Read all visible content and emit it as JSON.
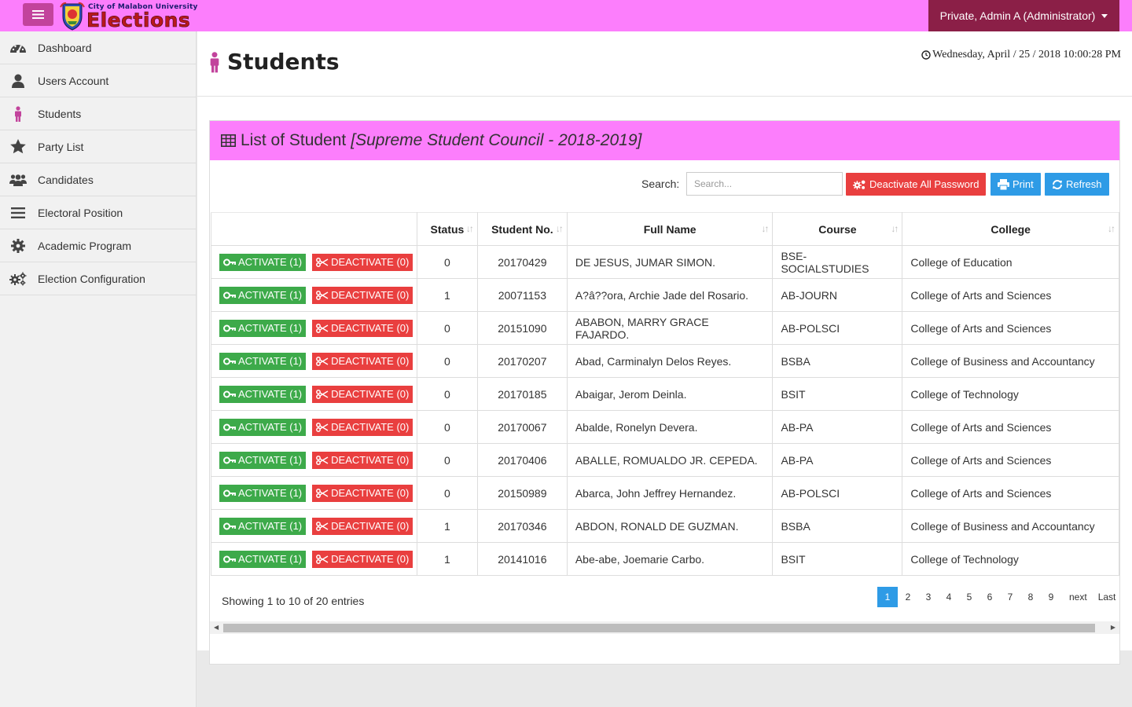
{
  "brand": {
    "top": "City of Malabon University",
    "main": "Elections"
  },
  "user_menu": "Private, Admin A (Administrator)",
  "sidebar": {
    "items": [
      {
        "label": "Dashboard",
        "icon": "dashboard-icon"
      },
      {
        "label": "Users Account",
        "icon": "user-icon"
      },
      {
        "label": "Students",
        "icon": "student-icon"
      },
      {
        "label": "Party List",
        "icon": "star-icon"
      },
      {
        "label": "Candidates",
        "icon": "users-icon"
      },
      {
        "label": "Electoral Position",
        "icon": "bars-icon"
      },
      {
        "label": "Academic Program",
        "icon": "gear-icon"
      },
      {
        "label": "Election Configuration",
        "icon": "gears-icon"
      }
    ]
  },
  "page": {
    "title": "Students",
    "datetime": "Wednesday, April / 25 / 2018 10:00:28 PM"
  },
  "panel": {
    "title": "List of Student",
    "subtitle": "[Supreme Student Council - 2018-2019]"
  },
  "toolbar": {
    "search_label": "Search:",
    "search_placeholder": "Search...",
    "deactivate_all": "Deactivate All Password",
    "print": "Print",
    "refresh": "Refresh"
  },
  "table": {
    "headers": [
      "Status",
      "Student No.",
      "Full Name",
      "Course",
      "College"
    ],
    "activate_label": "ACTIVATE (1)",
    "deactivate_label": "DEACTIVATE (0)",
    "rows": [
      {
        "status": "0",
        "student_no": "20170429",
        "name": "DE JESUS, JUMAR SIMON.",
        "course": "BSE-SOCIALSTUDIES",
        "college": "College of Education"
      },
      {
        "status": "1",
        "student_no": "20071153",
        "name": "A?â??ora, Archie Jade del Rosario.",
        "course": "AB-JOURN",
        "college": "College of Arts and Sciences"
      },
      {
        "status": "0",
        "student_no": "20151090",
        "name": "ABABON, MARRY GRACE FAJARDO.",
        "course": "AB-POLSCI",
        "college": "College of Arts and Sciences"
      },
      {
        "status": "0",
        "student_no": "20170207",
        "name": "Abad, Carminalyn Delos Reyes.",
        "course": "BSBA",
        "college": "College of Business and Accountancy"
      },
      {
        "status": "0",
        "student_no": "20170185",
        "name": "Abaigar, Jerom Deinla.",
        "course": "BSIT",
        "college": "College of Technology"
      },
      {
        "status": "0",
        "student_no": "20170067",
        "name": "Abalde, Ronelyn Devera.",
        "course": "AB-PA",
        "college": "College of Arts and Sciences"
      },
      {
        "status": "0",
        "student_no": "20170406",
        "name": "ABALLE, ROMUALDO JR. CEPEDA.",
        "course": "AB-PA",
        "college": "College of Arts and Sciences"
      },
      {
        "status": "0",
        "student_no": "20150989",
        "name": "Abarca, John Jeffrey Hernandez.",
        "course": "AB-POLSCI",
        "college": "College of Arts and Sciences"
      },
      {
        "status": "1",
        "student_no": "20170346",
        "name": "ABDON, RONALD DE GUZMAN.",
        "course": "BSBA",
        "college": "College of Business and Accountancy"
      },
      {
        "status": "1",
        "student_no": "20141016",
        "name": "Abe-abe, Joemarie Carbo.",
        "course": "BSIT",
        "college": "College of Technology"
      }
    ]
  },
  "footer": {
    "info": "Showing 1 to 10 of 20 entries",
    "pages": [
      "1",
      "2",
      "3",
      "4",
      "5",
      "6",
      "7",
      "8",
      "9"
    ],
    "next": "next",
    "last": "Last"
  },
  "colors": {
    "topbar": "#fc7efc",
    "accent": "#c2439c",
    "user_menu": "#8b1f47",
    "green": "#3daa4a",
    "red": "#e93f3f",
    "blue": "#2e9be6"
  }
}
